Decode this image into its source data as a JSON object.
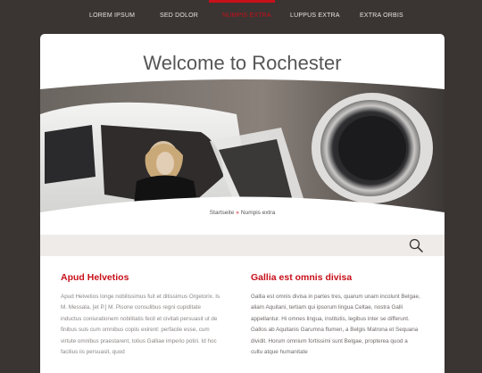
{
  "nav": {
    "items": [
      {
        "label": "LOREM IPSUM"
      },
      {
        "label": "SED DOLOR"
      },
      {
        "label": "NUMPIS EXTRA"
      },
      {
        "label": "LUPPUS EXTRA"
      },
      {
        "label": "EXTRA ORBIS"
      }
    ],
    "active_index": 2,
    "accent_color": "#c7101a"
  },
  "page": {
    "title": "Welcome to Rochester",
    "hero_image": "jet-cockpit-photo",
    "breadcrumb": {
      "home": "Startseite",
      "separator": "»",
      "current": "Numpis extra"
    },
    "search": {
      "icon": "search-icon"
    }
  },
  "content": {
    "left": {
      "heading": "Apud Helvetios",
      "text": "Apud Helvetios longe nobilissimus fuit et ditissimus Orgetorix. Is M. Messala, [et P.] M. Pisone consulibus regni cupiditate inductus coniurationem nobilitatis fecit et civitati persuasit ut de finibus suis cum omnibus copiis exirent: perfacile esse, cum virtute omnibus praestarent, totius Galliae imperio potiri. Id hoc facilius iis persuasit, quod"
    },
    "right": {
      "heading": "Gallia est omnis divisa",
      "text": "Gallia est omnis divisa in partes tres, quarum unam incolunt Belgae, aliam Aquitani, tertiam qui ipsorum lingua Celtae, nostra Galli appellantur. Hi omnes lingua, institutis, legibus inter se differunt. Gallos ab Aquitanis Garumna flumen, a Belgis Matrona et Sequana dividit. Horum omnium fortissimi sunt Belgae, propterea quod a cultu atque humanitate"
    }
  }
}
